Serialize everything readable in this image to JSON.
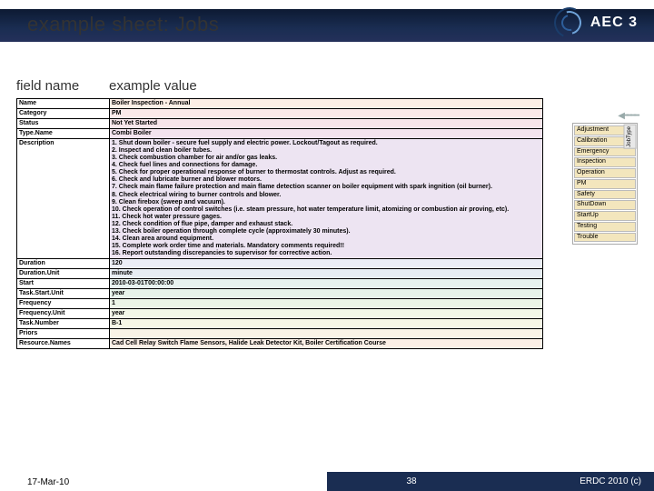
{
  "header": {
    "title": "example sheet: Jobs",
    "logo_text": "AEC 3"
  },
  "columns": {
    "field": "field name",
    "example": "example value"
  },
  "rows": [
    {
      "label": "Name",
      "value": "Boiler Inspection - Annual",
      "bg": 1
    },
    {
      "label": "Category",
      "value": "PM",
      "bg": 2
    },
    {
      "label": "Status",
      "value": "Not Yet Started",
      "bg": 3
    },
    {
      "label": "Type.Name",
      "value": "Combi Boiler",
      "bg": 4
    },
    {
      "label": "Description",
      "bg": 5,
      "lines": [
        "1. Shut down boiler - secure fuel supply and electric power. Lockout/Tagout as required.",
        "2. Inspect and clean boiler tubes.",
        "3. Check combustion chamber for air and/or gas leaks.",
        "4. Check fuel lines and connections for damage.",
        "5. Check for proper operational response of burner to thermostat controls. Adjust as required.",
        "6. Check and lubricate burner and blower motors.",
        "7. Check main flame failure protection and main flame detection scanner on boiler equipment with spark ingnition (oil burner).",
        "8. Check electrical wiring to burner controls and blower.",
        "9. Clean firebox (sweep and vacuum).",
        "10. Check operation of control switches (i.e. steam pressure, hot water temperature limit, atomizing or combustion air proving, etc).",
        "11. Check hot water pressure gages.",
        "12. Check condition of flue pipe, damper and exhaust stack.",
        "13. Check boiler operation through complete cycle (approximately 30 minutes).",
        "14. Clean area around equipment.",
        "15. Complete work order time and materials. Mandatory comments required!!",
        "16. Report outstanding discrepancies to supervisor for corrective action."
      ]
    },
    {
      "label": "Duration",
      "value": "120",
      "bg": 6
    },
    {
      "label": "Duration.Unit",
      "value": "minute",
      "bg": 7
    },
    {
      "label": "Start",
      "value": "2010-03-01T00:00:00",
      "bg": 8
    },
    {
      "label": "Task.Start.Unit",
      "value": "year",
      "bg": 9
    },
    {
      "label": "Frequency",
      "value": "1",
      "bg": 10
    },
    {
      "label": "Frequency.Unit",
      "value": "year",
      "bg": 11
    },
    {
      "label": "Task.Number",
      "value": "B-1",
      "bg": 12
    },
    {
      "label": "Priors",
      "value": "",
      "bg": 13
    },
    {
      "label": "Resource.Names",
      "value": "Cad Cell Relay Switch Flame Sensors, Halide Leak Detector Kit, Boiler Certification Course",
      "bg": 14
    }
  ],
  "callout": {
    "head": "JobType",
    "items": [
      "Adjustment",
      "Calibration",
      "Emergency",
      "Inspection",
      "Operation",
      "PM",
      "Safety",
      "ShutDown",
      "StartUp",
      "Testing",
      "Trouble"
    ]
  },
  "footer": {
    "date": "17-Mar-10",
    "page": "38",
    "credit": "ERDC 2010 (c)"
  }
}
